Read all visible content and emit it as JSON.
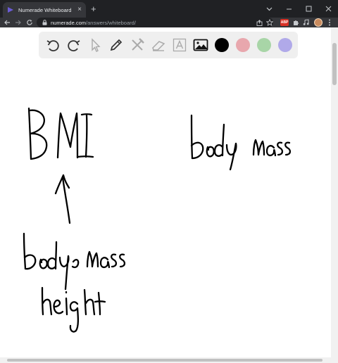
{
  "browser": {
    "tab_title": "Numerade Whiteboard",
    "url_host": "numerade.com",
    "url_path": "/answers/whiteboard/",
    "extension_badge": "ABP"
  },
  "whiteboard": {
    "tools": [
      "undo-icon",
      "redo-icon",
      "select-icon",
      "pen-icon",
      "tools-icon",
      "eraser-icon",
      "text-icon",
      "image-icon"
    ],
    "colors": [
      "#000000",
      "#e8a7ad",
      "#a8d5a7",
      "#b0a9e9"
    ],
    "selected_color": "#000000"
  },
  "canvas_text": [
    "BMI",
    "body mass",
    "body mass",
    "height"
  ]
}
